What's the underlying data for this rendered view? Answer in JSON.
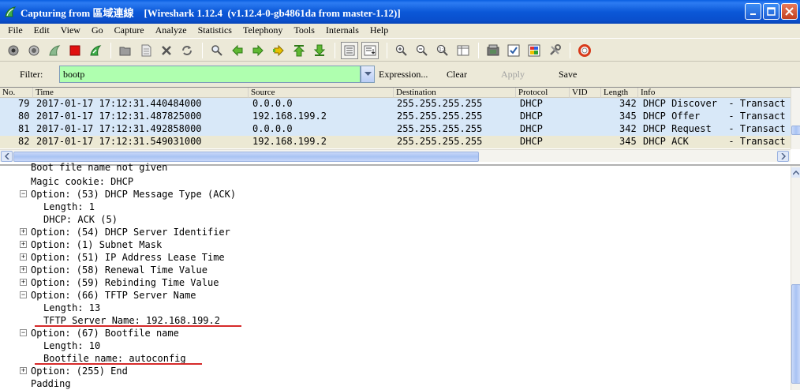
{
  "window": {
    "title": "Capturing from 區域連線    [Wireshark 1.12.4  (v1.12.4-0-gb4861da from master-1.12)]",
    "app_icon": "wireshark-fin-icon"
  },
  "menu": [
    "File",
    "Edit",
    "View",
    "Go",
    "Capture",
    "Analyze",
    "Statistics",
    "Telephony",
    "Tools",
    "Internals",
    "Help"
  ],
  "toolbar": {
    "buttons": [
      "interfaces-icon",
      "options-icon",
      "start-capture-icon",
      "stop-capture-icon",
      "restart-capture-icon",
      "open-file-icon",
      "save-file-icon",
      "close-file-icon",
      "reload-icon",
      "find-packet-icon",
      "go-back-icon",
      "go-forward-icon",
      "go-to-packet-icon",
      "go-first-icon",
      "go-last-icon",
      "colorize-icon",
      "autoscroll-icon",
      "zoom-in-icon",
      "zoom-out-icon",
      "normal-size-icon",
      "resize-columns-icon",
      "capture-filters-icon",
      "display-filters-icon",
      "coloring-rules-icon",
      "preferences-icon",
      "help-icon"
    ]
  },
  "filter": {
    "label": "Filter:",
    "value": "bootp",
    "expression": "Expression...",
    "clear": "Clear",
    "apply": "Apply",
    "save": "Save",
    "valid_color": "#afffaf"
  },
  "packet_list": {
    "columns": [
      "No.",
      "Time",
      "Source",
      "Destination",
      "Protocol",
      "VID",
      "Length",
      "Info"
    ],
    "rows": [
      {
        "no": "79",
        "time": "2017-01-17 17:12:31.440484000",
        "source": "0.0.0.0",
        "destination": "255.255.255.255",
        "protocol": "DHCP",
        "vid": "",
        "length": "342",
        "info": "DHCP Discover  - Transact"
      },
      {
        "no": "80",
        "time": "2017-01-17 17:12:31.487825000",
        "source": "192.168.199.2",
        "destination": "255.255.255.255",
        "protocol": "DHCP",
        "vid": "",
        "length": "345",
        "info": "DHCP Offer     - Transact"
      },
      {
        "no": "81",
        "time": "2017-01-17 17:12:31.492858000",
        "source": "0.0.0.0",
        "destination": "255.255.255.255",
        "protocol": "DHCP",
        "vid": "",
        "length": "342",
        "info": "DHCP Request   - Transact"
      },
      {
        "no": "82",
        "time": "2017-01-17 17:12:31.549031000",
        "source": "192.168.199.2",
        "destination": "255.255.255.255",
        "protocol": "DHCP",
        "vid": "",
        "length": "345",
        "info": "DHCP ACK       - Transact"
      }
    ],
    "row_color": "#d8e8f8",
    "selected_row": 3
  },
  "details": {
    "lines": [
      {
        "text": "Boot file name not given",
        "toggle": "none"
      },
      {
        "text": "Magic cookie: DHCP",
        "toggle": "none"
      },
      {
        "text": "Option: (53) DHCP Message Type (ACK)",
        "toggle": "expanded"
      },
      {
        "text": "Length: 1",
        "toggle": "none"
      },
      {
        "text": "DHCP: ACK (5)",
        "toggle": "none"
      },
      {
        "text": "Option: (54) DHCP Server Identifier",
        "toggle": "collapsed"
      },
      {
        "text": "Option: (1) Subnet Mask",
        "toggle": "collapsed"
      },
      {
        "text": "Option: (51) IP Address Lease Time",
        "toggle": "collapsed"
      },
      {
        "text": "Option: (58) Renewal Time Value",
        "toggle": "collapsed"
      },
      {
        "text": "Option: (59) Rebinding Time Value",
        "toggle": "collapsed"
      },
      {
        "text": "Option: (66) TFTP Server Name",
        "toggle": "expanded"
      },
      {
        "text": "Length: 13",
        "toggle": "none"
      },
      {
        "text": "TFTP Server Name: 192.168.199.2",
        "toggle": "none",
        "highlight": true
      },
      {
        "text": "Option: (67) Bootfile name",
        "toggle": "expanded"
      },
      {
        "text": "Length: 10",
        "toggle": "none"
      },
      {
        "text": "Bootfile name: autoconfig",
        "toggle": "none",
        "highlight": true
      },
      {
        "text": "Option: (255) End",
        "toggle": "collapsed"
      },
      {
        "text": "Padding",
        "toggle": "none"
      }
    ],
    "highlight_color": "#d62a2a"
  }
}
